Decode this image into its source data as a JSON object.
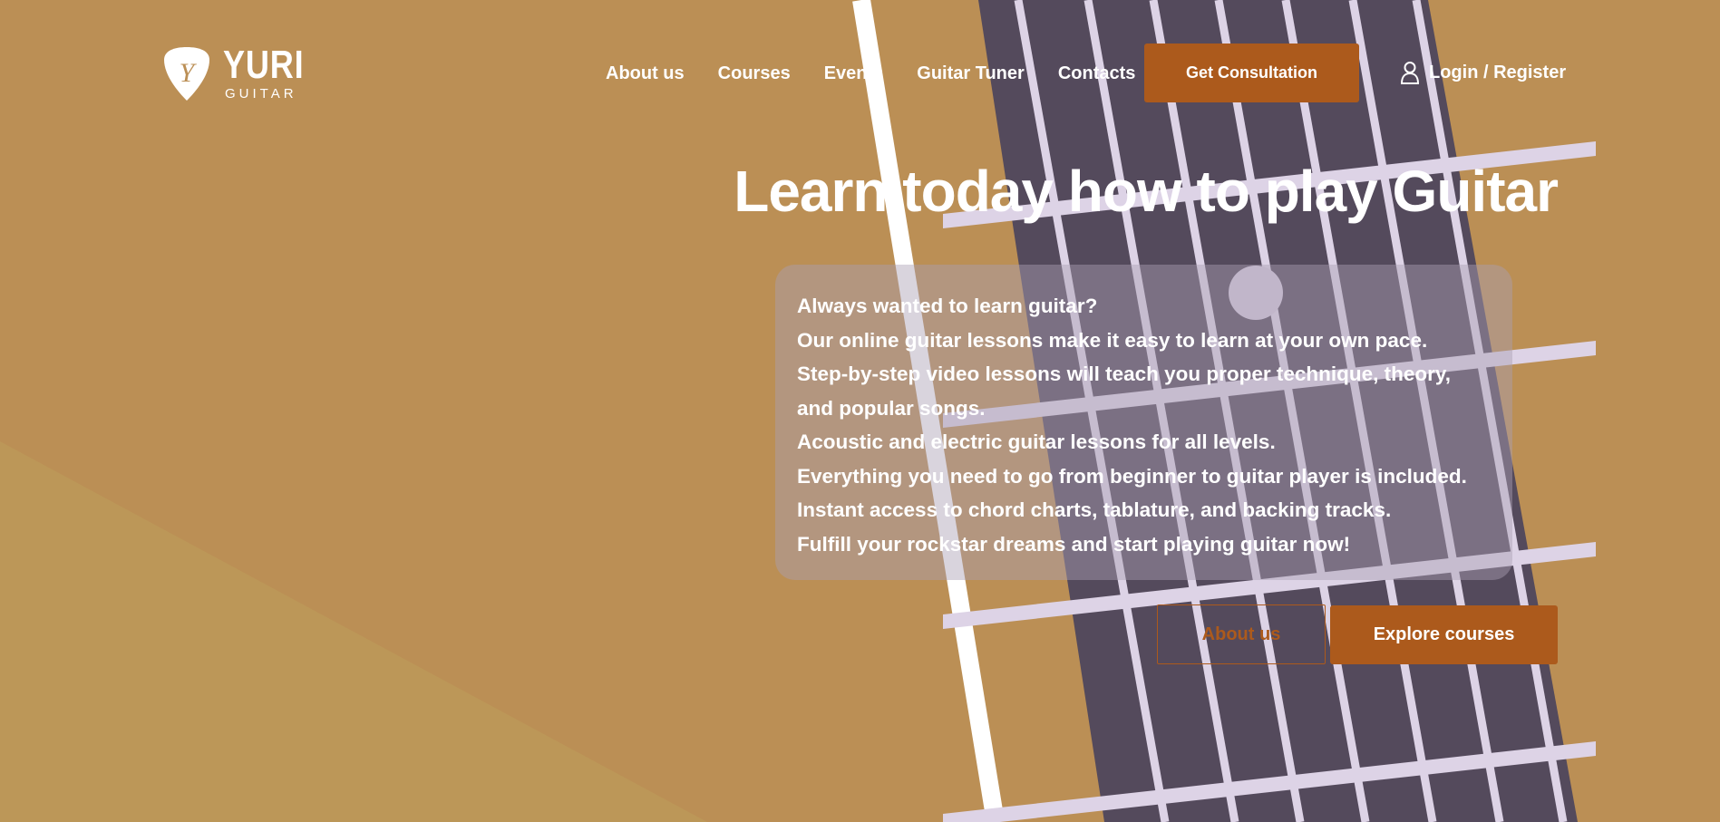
{
  "brand": {
    "name": "YURI",
    "sub": "GUITAR",
    "monogram": "Y"
  },
  "nav": {
    "items": [
      {
        "label": "About us"
      },
      {
        "label": "Courses"
      },
      {
        "label": "Events"
      },
      {
        "label": "Guitar Tuner"
      },
      {
        "label": "Contacts"
      }
    ],
    "consult_label": "Get Consultation",
    "login_label": "Login / Register",
    "login_icon": "user-icon"
  },
  "hero": {
    "title": "Learn today how to play Guitar",
    "lines": [
      "Always wanted to learn guitar?",
      "Our online guitar lessons make it easy to learn at your own pace.",
      "Step-by-step video lessons will teach you proper technique, theory,",
      "and popular songs.",
      "Acoustic and electric guitar lessons for all levels.",
      "Everything you need to go from beginner to guitar player is included.",
      "Instant access to chord charts, tablature, and backing tracks.",
      "Fulfill your rockstar dreams and start playing guitar now!"
    ],
    "about_label": "About us",
    "explore_label": "Explore courses"
  },
  "colors": {
    "background": "#bb8f55",
    "accent": "#ac5a1c",
    "fretboard": "#544a5c",
    "fret": "#ddd3e6"
  }
}
